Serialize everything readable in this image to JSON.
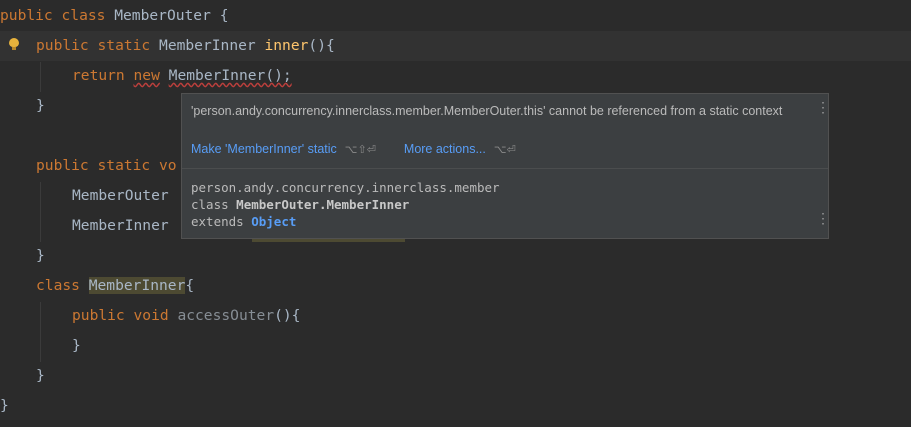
{
  "code": {
    "l1": {
      "kw": "public class",
      "name": "MemberOuter",
      "brace": "{"
    },
    "l2": {
      "kw": "public static",
      "type": "MemberInner",
      "fn": "inner",
      "rest": "(){"
    },
    "l3": {
      "kw_return": "return",
      "kw_new": "new",
      "call": "MemberInner();"
    },
    "l4": {
      "text": "}"
    },
    "l6": {
      "kw": "public static vo"
    },
    "l7": {
      "text": "MemberOuter"
    },
    "l8": {
      "text": "MemberInner"
    },
    "l9": {
      "text": "}"
    },
    "l10": {
      "kw": "class",
      "name": "MemberInner",
      "brace": "{"
    },
    "l11": {
      "kw": "public void",
      "fn": "accessOuter",
      "rest": "(){"
    },
    "l12": {
      "text": "}"
    },
    "l13": {
      "text": "}"
    },
    "l14": {
      "text": "}"
    }
  },
  "popup": {
    "message": "'person.andy.concurrency.innerclass.member.MemberOuter.this' cannot be referenced from a static context",
    "action_primary": "Make 'MemberInner' static",
    "action_primary_shortcut": "⌥⇧⏎",
    "action_more": "More actions...",
    "action_more_shortcut": "⌥⏎",
    "doc_package": "person.andy.concurrency.innerclass.member",
    "doc_class_kw": "class",
    "doc_class_name": "MemberOuter.MemberInner",
    "doc_extends_kw": "extends",
    "doc_extends_type": "Object",
    "menu_icon": "⋮"
  },
  "colors": {
    "background": "#2b2b2b",
    "keyword": "#cc7832",
    "text": "#a9b7c6",
    "method": "#ffc66d",
    "link": "#589df6",
    "bulb": "#e8b33c"
  },
  "icons": [
    "lightbulb-icon",
    "more-options-icon"
  ]
}
